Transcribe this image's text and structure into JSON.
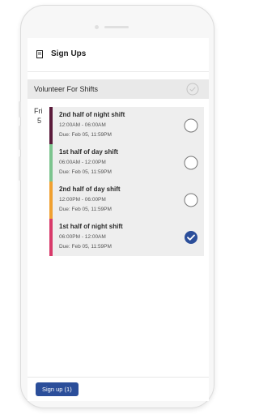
{
  "header": {
    "title": "Sign Ups",
    "icon": "document-icon"
  },
  "volunteer": {
    "label": "Volunteer For Shifts",
    "checked": false
  },
  "date": {
    "day": "Fri",
    "num": "5"
  },
  "shifts": [
    {
      "title": "2nd half of night shift",
      "time": "12:00AM - 06:00AM",
      "due": "Due: Feb 05, 11:59PM",
      "color": "#5a1a3a",
      "checked": false
    },
    {
      "title": "1st half of day shift",
      "time": "06:00AM - 12:00PM",
      "due": "Due: Feb 05, 11:59PM",
      "color": "#7cc48e",
      "checked": false
    },
    {
      "title": "2nd half of day shift",
      "time": "12:00PM - 06:00PM",
      "due": "Due: Feb 05, 11:59PM",
      "color": "#f0a030",
      "checked": false
    },
    {
      "title": "1st half of night shift",
      "time": "06:00PM - 12:00AM",
      "due": "Due: Feb 05, 11:59PM",
      "color": "#d83a6a",
      "checked": true
    }
  ],
  "footer": {
    "signup_label": "Sign up (1)"
  },
  "colors": {
    "accent": "#2b4e9a"
  }
}
